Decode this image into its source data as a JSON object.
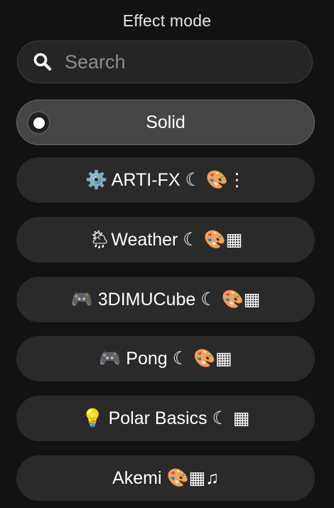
{
  "header": {
    "title": "Effect mode"
  },
  "search": {
    "placeholder": "Search",
    "value": "",
    "icon": "search-icon"
  },
  "effects": {
    "selected": "Solid",
    "items": [
      {
        "label": "Solid",
        "selected": true
      },
      {
        "label": "⚙️ ARTI-FX ☾ 🎨⋮",
        "selected": false
      },
      {
        "label": "🌦Weather ☾ 🎨▦",
        "selected": false
      },
      {
        "label": "🎮 3DIMUCube ☾ 🎨▦",
        "selected": false
      },
      {
        "label": "🎮 Pong ☾ 🎨▦",
        "selected": false
      },
      {
        "label": "💡 Polar Basics ☾ ▦",
        "selected": false
      },
      {
        "label": "Akemi 🎨▦♫",
        "selected": false
      }
    ]
  },
  "colors": {
    "background": "#121212",
    "item_background": "#2a2a2a",
    "selected_background": "#454545",
    "text": "#ffffff",
    "placeholder": "#8e8e8e"
  }
}
